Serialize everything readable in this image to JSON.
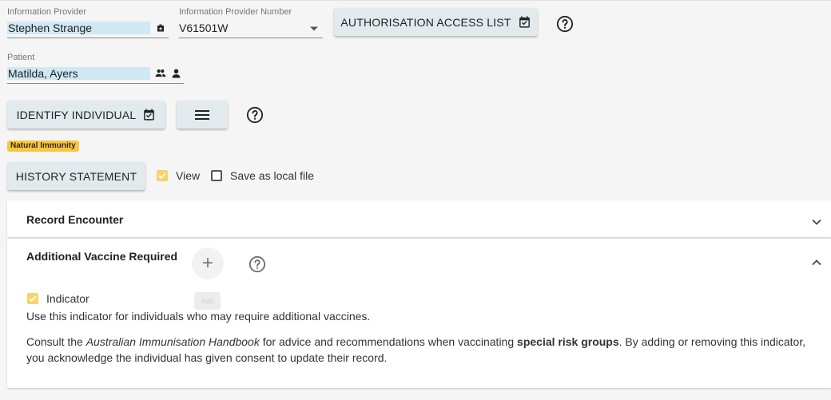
{
  "provider": {
    "label": "Information Provider",
    "value": "Stephen Strange",
    "icon": "medical-bag-icon"
  },
  "provider_number": {
    "label": "Information Provider Number",
    "value": "V61501W",
    "icon": "dropdown-arrow-icon"
  },
  "auth_button": {
    "label": "Authorisation Access List",
    "icon": "calendar-check-icon"
  },
  "patient": {
    "label": "Patient",
    "value": "Matilda, Ayers",
    "icons": [
      "group-icon",
      "person-icon"
    ]
  },
  "identify_button": {
    "label": "Identify Individual",
    "icon": "calendar-check-icon"
  },
  "menu_button": {
    "icon": "hamburger-menu-icon"
  },
  "badge": "Natural Immunity",
  "history_button": {
    "label": "History Statement"
  },
  "view_option": {
    "label": "View",
    "checked": true
  },
  "save_option": {
    "label": "Save as local file",
    "checked": false
  },
  "record_encounter": {
    "title": "Record Encounter",
    "expanded": false
  },
  "additional_vaccine": {
    "title": "Additional Vaccine Required",
    "expanded": true,
    "add_tooltip": "Add",
    "indicator_label": "Indicator",
    "indicator_checked": true,
    "description": "Use this indicator for individuals who may require additional vaccines.",
    "consult": {
      "prefix": "Consult the ",
      "book": "Australian Immunisation Handbook",
      "middle": " for advice and recommendations when vaccinating ",
      "bold": "special risk groups",
      "suffix": ". By adding or removing this indicator, you acknowledge the individual has given consent to update their record."
    }
  },
  "colors": {
    "accent_yellow": "#f8c644",
    "highlight_blue": "#cfe8f3",
    "button_bg": "#e3eaee"
  }
}
